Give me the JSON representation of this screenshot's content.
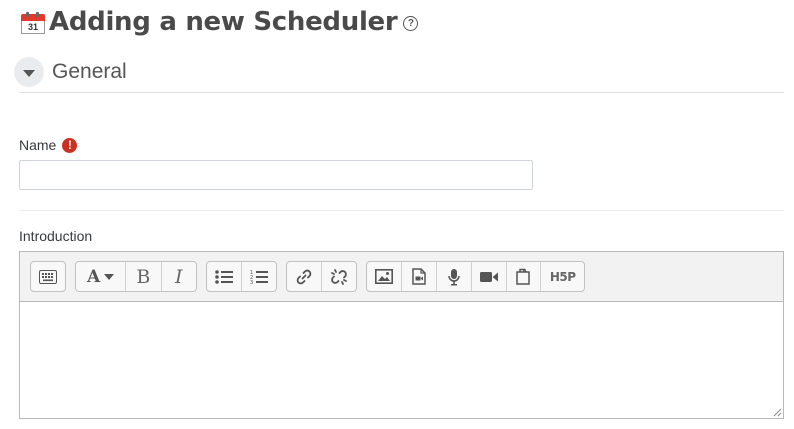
{
  "header": {
    "title": "Adding a new Scheduler",
    "calendar_day": "31",
    "help_glyph": "?"
  },
  "section": {
    "title": "General"
  },
  "fields": {
    "name": {
      "label": "Name",
      "required_glyph": "!",
      "value": "",
      "placeholder": ""
    },
    "introduction": {
      "label": "Introduction"
    }
  },
  "toolbar": {
    "groups": [
      [
        "show-more-buttons-icon"
      ],
      [
        "font-style-icon",
        "bold-icon",
        "italic-icon"
      ],
      [
        "unordered-list-icon",
        "ordered-list-icon"
      ],
      [
        "link-icon",
        "unlink-icon"
      ],
      [
        "image-icon",
        "media-icon",
        "record-audio-icon",
        "record-video-icon",
        "manage-files-icon",
        "h5p-icon"
      ]
    ],
    "bold_glyph": "B",
    "italic_glyph": "I",
    "font_glyph": "A",
    "h5p_text": "H5P"
  },
  "colors": {
    "title": "#4a4a4a",
    "required": "#ca3120",
    "toolbar_bg": "#f2f2f2",
    "border": "#b8b8b8"
  }
}
